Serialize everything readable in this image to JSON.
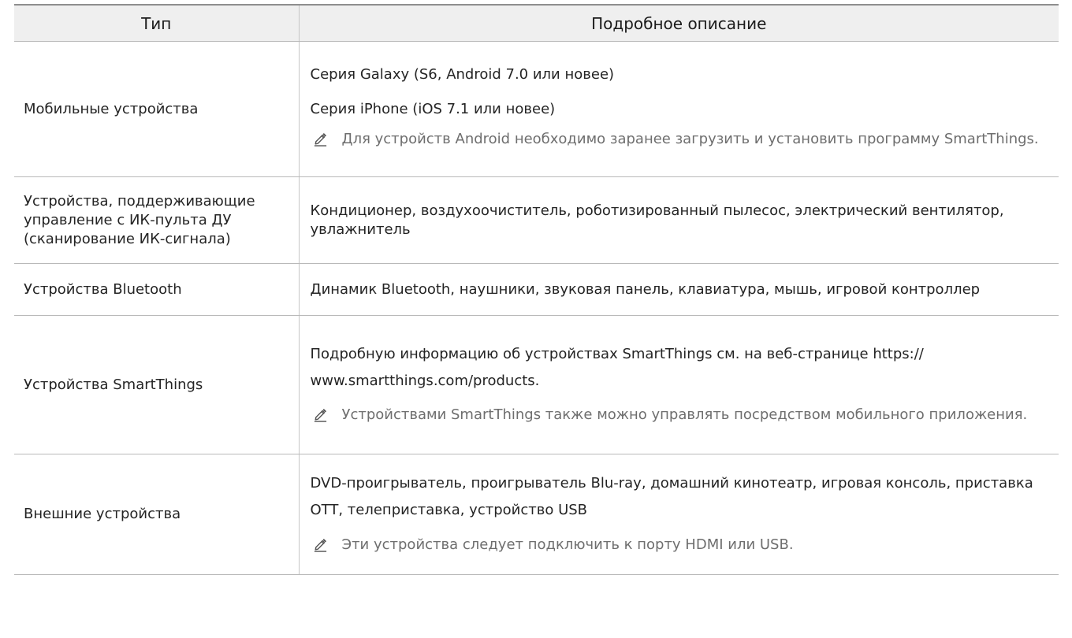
{
  "table": {
    "headers": {
      "type": "Тип",
      "description": "Подробное описание"
    },
    "icon": "pencil-note-icon",
    "rows": [
      {
        "type": "Мобильные устройства",
        "lines": [
          "Серия Galaxy (S6, Android 7.0 или новее)",
          "Серия iPhone (iOS 7.1 или новее)"
        ],
        "note": "Для устройств Android необходимо заранее загрузить и установить программу SmartThings."
      },
      {
        "type": "Устройства, поддерживающие управление с ИК-пульта ДУ (сканирование ИК-сигнала)",
        "lines": [
          "Кондиционер, воздухоочиститель, роботизированный пылесос, электрический вентилятор, увлажнитель"
        ]
      },
      {
        "type": "Устройства Bluetooth",
        "lines": [
          "Динамик Bluetooth, наушники, звуковая панель, клавиатура, мышь, игровой контроллер"
        ]
      },
      {
        "type": "Устройства SmartThings",
        "lines": [
          "Подробную информацию об устройствах SmartThings см. на веб-странице https:// www.smartthings.com/products."
        ],
        "note": "Устройствами SmartThings также можно управлять посредством мобильного приложения."
      },
      {
        "type": "Внешние устройства",
        "lines": [
          "DVD-проигрыватель, проигрыватель Blu-ray, домашний кинотеатр, игровая консоль, приставка OTT, телеприставка, устройство USB"
        ],
        "note": "Эти устройства следует подключить к порту HDMI или USB."
      }
    ]
  }
}
